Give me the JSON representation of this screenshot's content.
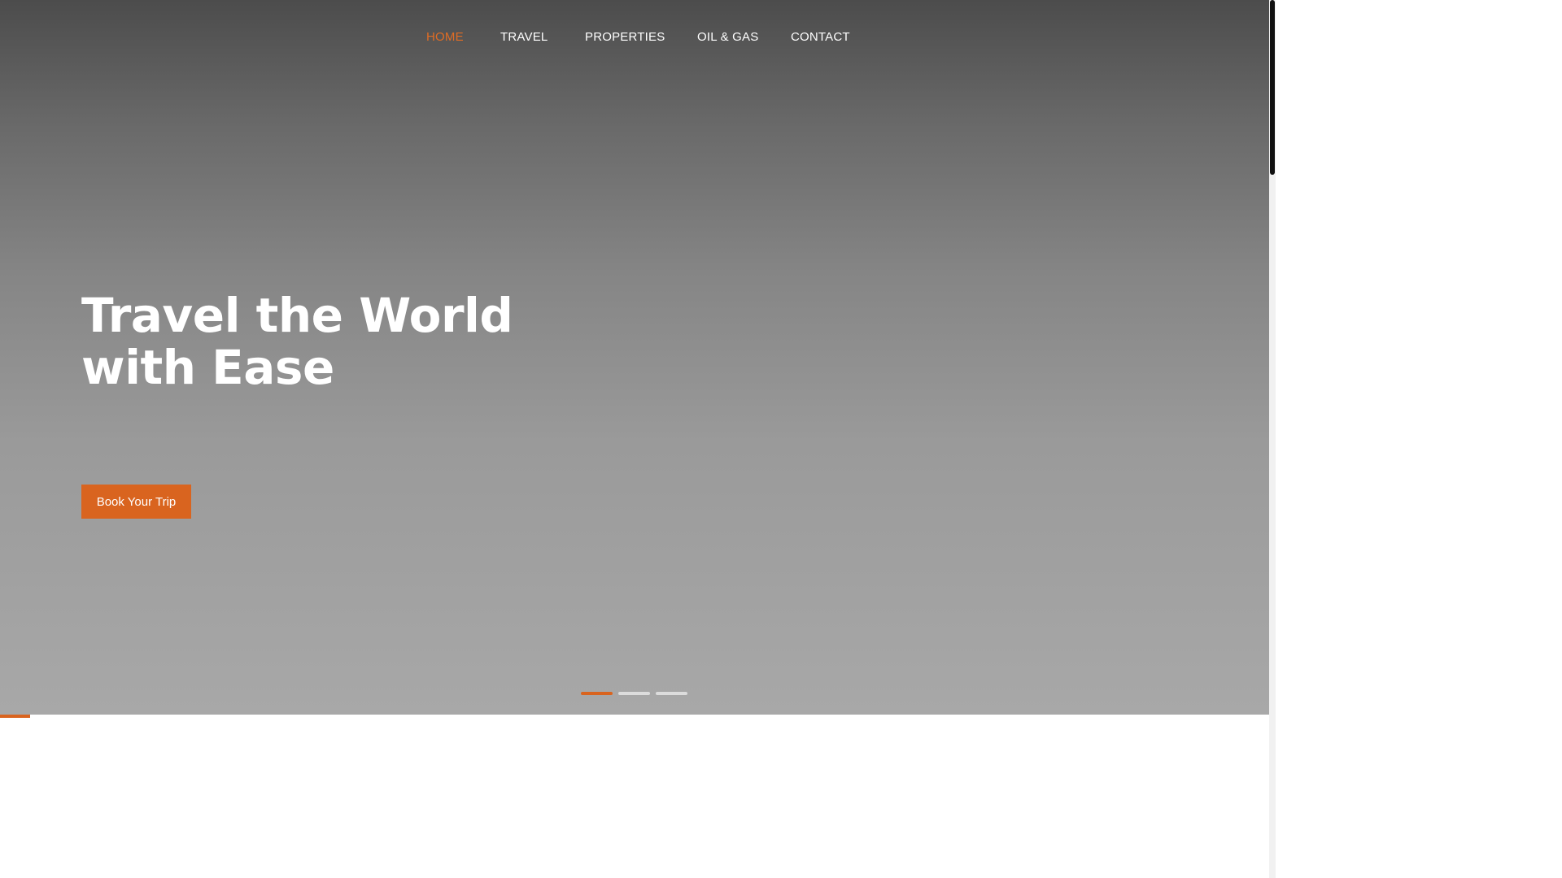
{
  "nav": {
    "items": [
      {
        "label": "HOME",
        "active": true
      },
      {
        "label": "TRAVEL",
        "active": false
      },
      {
        "label": "PROPERTIES",
        "active": false
      },
      {
        "label": "OIL & GAS",
        "active": false
      },
      {
        "label": "CONTACT",
        "active": false
      }
    ]
  },
  "hero": {
    "headline_line1": "Travel the World",
    "headline_line2": "with Ease",
    "cta_label": "Book Your Trip"
  },
  "slider": {
    "slide_count": 3,
    "active_index": 0,
    "progress_fraction": 0.024
  },
  "colors": {
    "accent": "#d9641f",
    "nav_active": "#e06c24",
    "text": "#ffffff"
  }
}
